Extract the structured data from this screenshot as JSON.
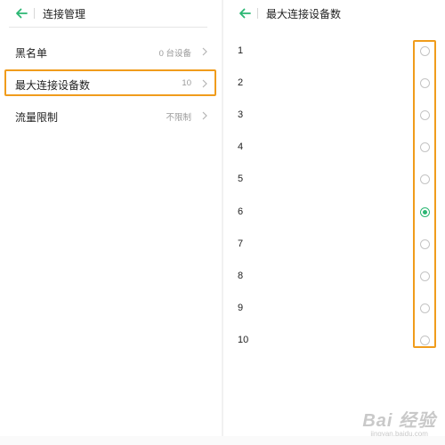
{
  "left": {
    "title": "连接管理",
    "rows": [
      {
        "label": "黑名单",
        "value": "0 台设备"
      },
      {
        "label": "最大连接设备数",
        "value": "10"
      },
      {
        "label": "流量限制",
        "value": "不限制"
      }
    ]
  },
  "right": {
    "title": "最大连接设备数",
    "options": [
      "1",
      "2",
      "3",
      "4",
      "5",
      "6",
      "7",
      "8",
      "9",
      "10"
    ],
    "selected": "6"
  },
  "watermark": {
    "line1": "Bai 经验",
    "line2": "jingyan.baidu.com"
  },
  "colors": {
    "accent": "#2bb673",
    "highlight": "#f09c1c"
  }
}
